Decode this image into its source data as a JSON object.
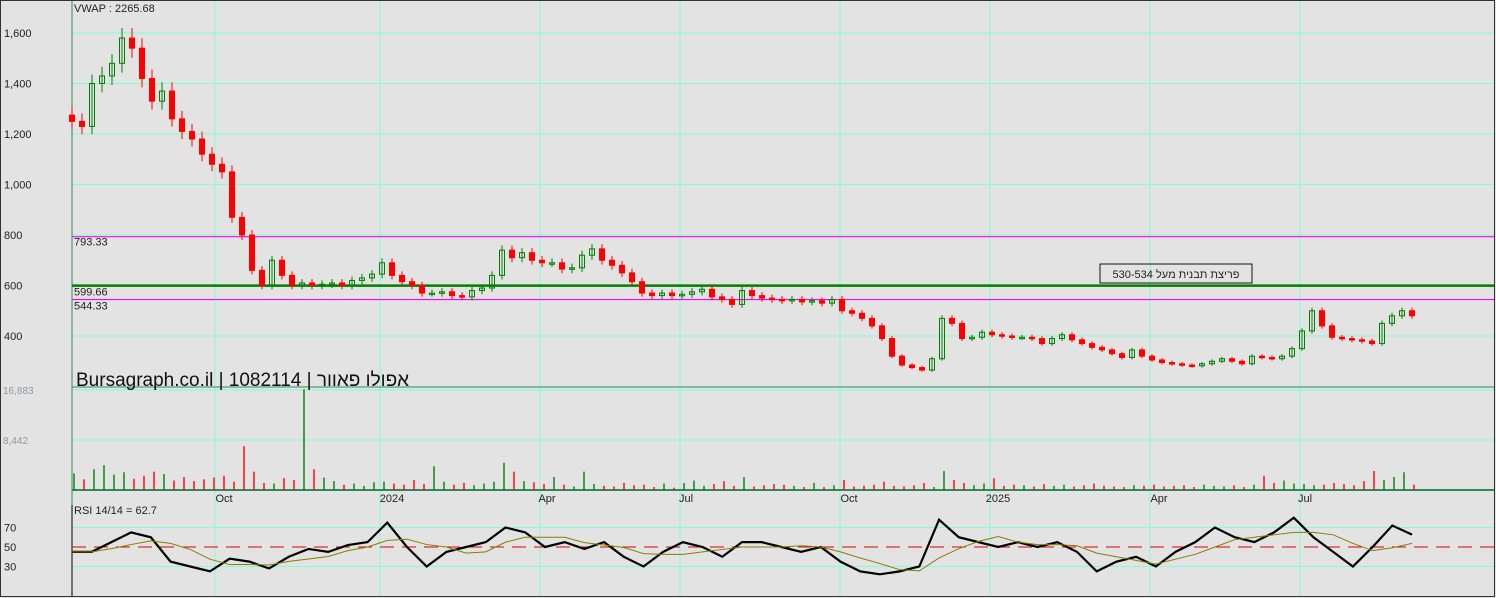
{
  "chart_data": {
    "type": "candlestick",
    "title": "Bursagraph.co.il | 1082114 | אפולו פאוור",
    "vwap_label": "VWAP  : 2265.68",
    "price_axis": {
      "ylim": [
        240,
        1680
      ],
      "ticks": [
        400,
        600,
        800,
        1000,
        1200,
        1400,
        1600
      ],
      "tick_labels": [
        "400",
        "600",
        "800",
        "1,000",
        "1,200",
        "1,400",
        "1,600"
      ]
    },
    "x_tick_labels": [
      "Oct",
      "2024",
      "Apr",
      "Jul",
      "Oct",
      "2025",
      "Apr",
      "Jul"
    ],
    "levels": [
      {
        "value": 793.33,
        "label": "793.33",
        "color": "#ff00ff"
      },
      {
        "value": 599.66,
        "label": "599.66",
        "color": "#008000"
      },
      {
        "value": 544.33,
        "label": "544.33",
        "color": "#ff00ff"
      }
    ],
    "annotation": "פריצת תבנית מעל 530-534",
    "closes": [
      1250,
      1230,
      1400,
      1430,
      1480,
      1580,
      1540,
      1420,
      1330,
      1370,
      1260,
      1210,
      1180,
      1120,
      1080,
      1050,
      870,
      800,
      660,
      600,
      700,
      640,
      600,
      610,
      600,
      605,
      610,
      600,
      620,
      630,
      645,
      690,
      640,
      615,
      600,
      570,
      570,
      575,
      560,
      555,
      580,
      590,
      640,
      740,
      710,
      730,
      700,
      690,
      690,
      665,
      670,
      720,
      745,
      700,
      680,
      650,
      615,
      570,
      560,
      570,
      560,
      565,
      575,
      585,
      555,
      545,
      525,
      580,
      560,
      550,
      545,
      540,
      545,
      535,
      540,
      530,
      545,
      500,
      490,
      470,
      440,
      390,
      320,
      285,
      275,
      265,
      310,
      470,
      450,
      390,
      395,
      415,
      405,
      400,
      395,
      395,
      390,
      370,
      390,
      405,
      385,
      370,
      355,
      345,
      330,
      315,
      345,
      320,
      305,
      295,
      290,
      285,
      282,
      290,
      300,
      310,
      300,
      290,
      320,
      315,
      310,
      320,
      350,
      420,
      500,
      440,
      395,
      390,
      385,
      380,
      370,
      450,
      480,
      500,
      480
    ],
    "volume": {
      "tick_labels": [
        "16,883",
        "8,442"
      ],
      "ticks": [
        16883,
        8442
      ],
      "values": [
        2800,
        1800,
        3500,
        4200,
        2600,
        3000,
        1900,
        2400,
        3100,
        2700,
        1600,
        2200,
        1500,
        1800,
        2100,
        2400,
        1400,
        7400,
        3100,
        1200,
        1100,
        2000,
        1700,
        17000,
        3500,
        2100,
        1500,
        900,
        1100,
        700,
        1300,
        1400,
        1100,
        900,
        1700,
        1000,
        4000,
        1400,
        900,
        1200,
        800,
        1100,
        1400,
        4600,
        3100,
        1500,
        1300,
        1000,
        2200,
        900,
        600,
        3100,
        1000,
        700,
        600,
        1200,
        800,
        900,
        500,
        1100,
        400,
        1200,
        1600,
        700,
        1000,
        1500,
        700,
        2200,
        600,
        800,
        1000,
        900,
        700,
        500,
        1200,
        500,
        800,
        1700,
        600,
        700,
        900,
        1400,
        700,
        600,
        800,
        1200,
        500,
        3200,
        1700,
        1200,
        800,
        1100,
        2000,
        700,
        900,
        800,
        600,
        1000,
        700,
        900,
        600,
        800,
        1100,
        700,
        600,
        500,
        800,
        700,
        900,
        600,
        700,
        800,
        500,
        900,
        700,
        600,
        800,
        500,
        900,
        2400,
        1200,
        1600,
        1100,
        1000,
        800,
        900,
        1200,
        1000,
        800,
        1500,
        3200,
        1700,
        2200,
        3000,
        900
      ]
    },
    "rsi": {
      "label": "RSI 14/14 = 62.7",
      "ticks": [
        30,
        50,
        70
      ],
      "ylim": [
        10,
        95
      ],
      "values": [
        45,
        45,
        55,
        65,
        60,
        35,
        30,
        25,
        38,
        35,
        28,
        40,
        48,
        45,
        52,
        55,
        75,
        50,
        30,
        45,
        50,
        55,
        70,
        65,
        50,
        55,
        48,
        55,
        40,
        30,
        45,
        55,
        50,
        40,
        55,
        55,
        50,
        45,
        50,
        35,
        25,
        22,
        25,
        30,
        78,
        60,
        55,
        50,
        55,
        50,
        55,
        45,
        25,
        35,
        40,
        30,
        45,
        55,
        70,
        60,
        55,
        65,
        80,
        60,
        45,
        30,
        50,
        72,
        62.7
      ]
    },
    "colors": {
      "up": "#008000",
      "down": "#ff0000",
      "grid": "#7fffd4",
      "rsi_line": "#000000",
      "rsi_ma": "#808000",
      "rsi_mid": "#e00000"
    }
  }
}
